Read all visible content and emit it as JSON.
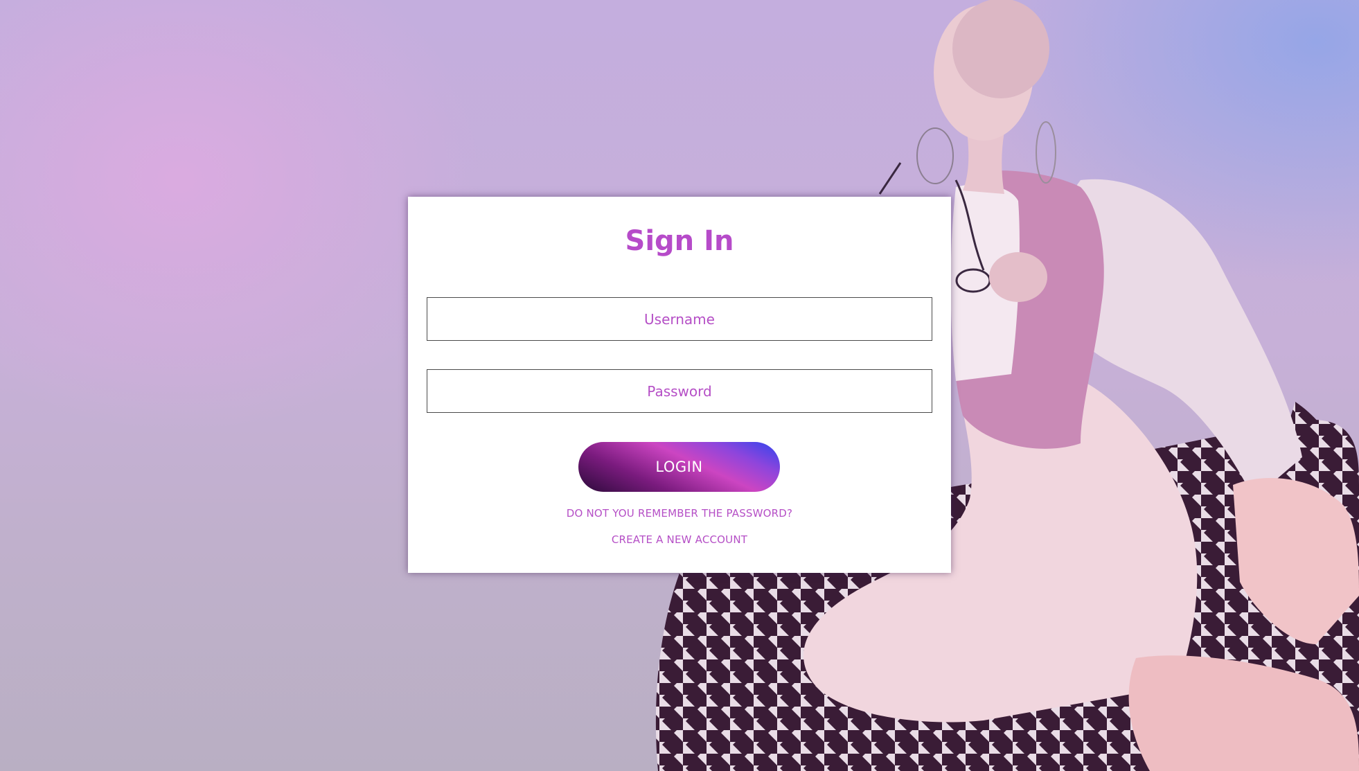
{
  "login_card": {
    "title": "Sign In",
    "username_placeholder": "Username",
    "password_placeholder": "Password",
    "login_label": "LOGIN",
    "forgot_password_label": "DO NOT YOU REMEMBER THE PASSWORD?",
    "create_account_label": "CREATE A NEW ACCOUNT"
  },
  "colors": {
    "accent": "#b64bc9",
    "button_gradient_start": "#2c0a3a",
    "button_gradient_mid": "#cc45c2",
    "button_gradient_end": "#2f45ee",
    "card_background": "#ffffff"
  },
  "background": {
    "image": "person-seated-on-houndstooth-chair-photo"
  }
}
